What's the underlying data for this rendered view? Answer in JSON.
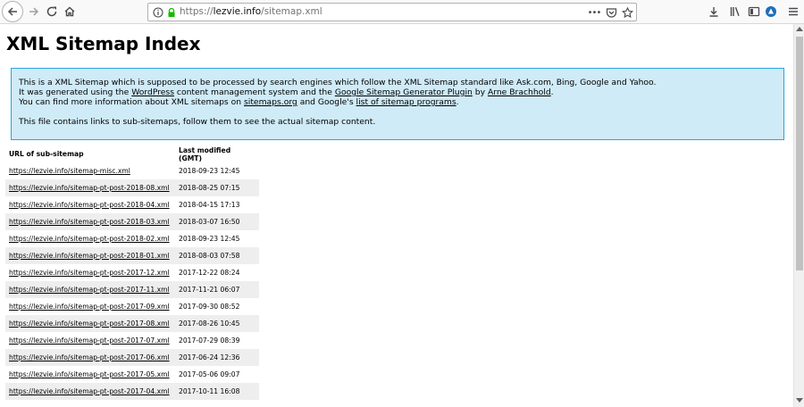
{
  "browser": {
    "url_prefix": "https://",
    "url_domain": "lezvie.info",
    "url_path": "/sitemap.xml",
    "page_actions": "•••"
  },
  "page": {
    "title": "XML Sitemap Index",
    "intro": {
      "l1": "This is a XML Sitemap which is supposed to be processed by search engines which follow the XML Sitemap standard like Ask.com, Bing, Google and Yahoo.",
      "l2_a": "It was generated using the ",
      "l2_link1": "WordPress",
      "l2_b": " content management system and the ",
      "l2_link2": "Google Sitemap Generator Plugin",
      "l2_c": " by ",
      "l2_link3": "Arne Brachhold",
      "l2_d": ".",
      "l3_a": "You can find more information about XML sitemaps on ",
      "l3_link1": "sitemaps.org",
      "l3_b": " and Google's ",
      "l3_link2": "list of sitemap programs",
      "l3_c": ".",
      "l4": "This file contains links to sub-sitemaps, follow them to see the actual sitemap content."
    },
    "table": {
      "headers": [
        "URL of sub-sitemap",
        "Last modified (GMT)"
      ],
      "rows": [
        {
          "url": "https://lezvie.info/sitemap-misc.xml",
          "modified": "2018-09-23 12:45"
        },
        {
          "url": "https://lezvie.info/sitemap-pt-post-2018-08.xml",
          "modified": "2018-08-25 07:15"
        },
        {
          "url": "https://lezvie.info/sitemap-pt-post-2018-04.xml",
          "modified": "2018-04-15 17:13"
        },
        {
          "url": "https://lezvie.info/sitemap-pt-post-2018-03.xml",
          "modified": "2018-03-07 16:50"
        },
        {
          "url": "https://lezvie.info/sitemap-pt-post-2018-02.xml",
          "modified": "2018-09-23 12:45"
        },
        {
          "url": "https://lezvie.info/sitemap-pt-post-2018-01.xml",
          "modified": "2018-08-03 07:58"
        },
        {
          "url": "https://lezvie.info/sitemap-pt-post-2017-12.xml",
          "modified": "2017-12-22 08:24"
        },
        {
          "url": "https://lezvie.info/sitemap-pt-post-2017-11.xml",
          "modified": "2017-11-21 06:07"
        },
        {
          "url": "https://lezvie.info/sitemap-pt-post-2017-09.xml",
          "modified": "2017-09-30 08:52"
        },
        {
          "url": "https://lezvie.info/sitemap-pt-post-2017-08.xml",
          "modified": "2017-08-26 10:45"
        },
        {
          "url": "https://lezvie.info/sitemap-pt-post-2017-07.xml",
          "modified": "2017-07-29 08:39"
        },
        {
          "url": "https://lezvie.info/sitemap-pt-post-2017-06.xml",
          "modified": "2017-06-24 12:36"
        },
        {
          "url": "https://lezvie.info/sitemap-pt-post-2017-05.xml",
          "modified": "2017-05-06 09:07"
        },
        {
          "url": "https://lezvie.info/sitemap-pt-post-2017-04.xml",
          "modified": "2017-10-11 16:08"
        }
      ]
    }
  },
  "colors": {
    "intro_bg": "#cfebf7",
    "intro_border": "#2aa6db",
    "row_alt": "#eeeeee",
    "lock_green": "#12bc00"
  }
}
